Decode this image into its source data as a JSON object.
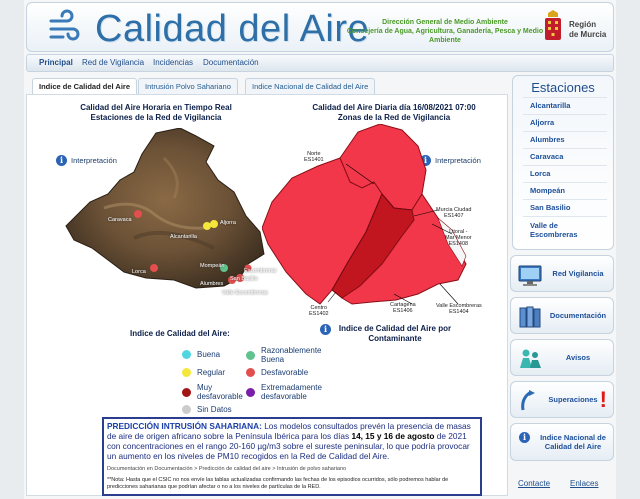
{
  "header": {
    "title": "Calidad del Aire",
    "gov_line1": "Dirección General de Medio Ambiente",
    "gov_line2": "Consejería de Agua, Agricultura, Ganadería, Pesca y Medio",
    "gov_line3": "Ambiente",
    "region_line1": "Región",
    "region_line2": "de Murcia"
  },
  "nav": {
    "items": [
      "Principal",
      "Red de Vigilancia",
      "Incidencias",
      "Documentación"
    ]
  },
  "tabs": [
    "Indice de Calidad del Aire",
    "Intrusión Polvo Sahariano",
    "Indice Nacional de Calidad del Aire"
  ],
  "left_map": {
    "title_line1": "Calidad del Aire Horaria en Tiempo Real",
    "title_line2": "Estaciones de la Red de Vigilancia",
    "interp": "Interpretación",
    "stations": [
      "Caravaca",
      "Lorca",
      "Alcantarilla",
      "Aljorra",
      "Mompeán",
      "Alumbres",
      "Escombreras",
      "San Basilio",
      "Valle Escombreras"
    ]
  },
  "right_map": {
    "title_line1": "Calidad del Aire Diaria día 16/08/2021 07:00",
    "title_line2": "Zonas de la Red de Vigilancia",
    "interp": "Interpretación",
    "zones": {
      "norte": "Norte",
      "norte_code": "ES1401",
      "murcia": "Murcia Ciudad",
      "murcia_code": "ES1407",
      "litoral": "Litoral -",
      "litoral2": "Mar Menor",
      "litoral_code": "ES1408",
      "centro": "Centro",
      "centro_code": "ES1402",
      "cartagena": "Cartagena",
      "cartagena_code": "ES1406",
      "valle": "Valle Escombreras",
      "valle_code": "ES1404"
    },
    "zone_fill": "#f2374a"
  },
  "legend": {
    "title": "Indice de Calidad del Aire:",
    "items": [
      {
        "label": "Buena",
        "color": "#4fd6e0"
      },
      {
        "label": "Razonablemente Buena",
        "color": "#5fc38d"
      },
      {
        "label": "Regular",
        "color": "#f5e63a"
      },
      {
        "label": "Desfavorable",
        "color": "#e34e4e"
      },
      {
        "label": "Muy desfavorable",
        "color": "#a31414"
      },
      {
        "label": "Extremadamente desfavorable",
        "color": "#7a1fa8"
      },
      {
        "label": "Sin Datos",
        "color": "#cccccc"
      }
    ]
  },
  "contaminante": {
    "line1": "Indice de Calidad del Aire por",
    "line2": "Contaminante"
  },
  "prediction": {
    "heading": "PREDICCIÓN INTRUSIÓN SAHARIANA:",
    "text_a": " Los modelos consultados prevén la presencia de masas de aire de origen africano sobre la Península Ibérica para los días ",
    "days": "14, 15 y 16 de agosto",
    "text_b": " de 2021 con concentraciones en el rango 20-160 µg/m3 sobre el sureste peninsular, lo que podría provocar un aumento en los niveles de PM10 recogidos en la Red de Calidad del Aire.",
    "links": "Documentación en Documentación > Predicción de calidad del aire > Intrusión de polvo sahariano",
    "note": "**Nota: Hasta que el CSIC no nos envíe las tablas actualizadas confirmando las fechas de los episodios ocurridos, sólo podremos hablar de predicciones saharianas que podrían afectar o no a los niveles de partículas de la RED."
  },
  "sidebar": {
    "title": "Estaciones",
    "stations": [
      "Alcantarilla",
      "Aljorra",
      "Alumbres",
      "Caravaca",
      "Lorca",
      "Mompeán",
      "San Basilio",
      "Valle de",
      "Escombreras"
    ],
    "buttons": [
      {
        "label": "Red Vigilancia",
        "icon": "monitor-icon"
      },
      {
        "label": "Documentación",
        "icon": "binders-icon"
      },
      {
        "label": "Avisos",
        "icon": "people-icon"
      },
      {
        "label": "Superaciones",
        "icon": "alert-icon"
      },
      {
        "label": "Indice Nacional de Calidad del Aire",
        "icon": "info-icon"
      }
    ]
  },
  "footer": {
    "contacto": "Contacte",
    "enlaces": "Enlaces"
  }
}
